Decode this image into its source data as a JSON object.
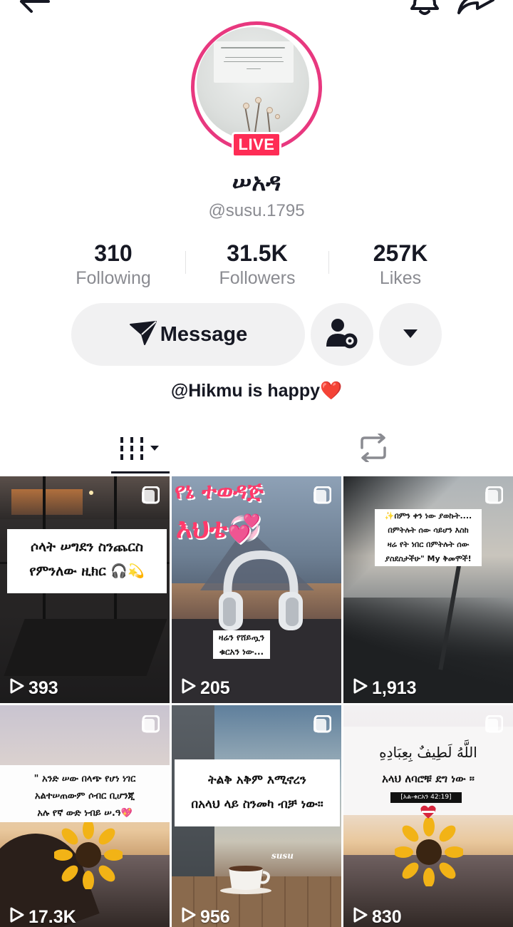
{
  "profile": {
    "name": "ሠአዳ",
    "handle": "@susu.1795",
    "live_badge": "LIVE",
    "bio": "@Hikmu is happy❤️"
  },
  "stats": [
    {
      "value": "310",
      "label": "Following"
    },
    {
      "value": "31.5K",
      "label": "Followers"
    },
    {
      "value": "257K",
      "label": "Likes"
    }
  ],
  "actions": {
    "message_label": "Message"
  },
  "tabs": {
    "videos_icon": "grid-icon",
    "reposts_icon": "repost-icon"
  },
  "videos": [
    {
      "views": "393",
      "caption": [
        "ሶላት ሠግደን ስንጨርስ",
        "የምንለው ዚክር 🎧💫"
      ]
    },
    {
      "views": "205",
      "headline": "የኔ ተወዳጅ",
      "headline2": "እህቴ💞",
      "caption": [
        "ዛሬን የሸይጧን",
        "ቁርአን ነው..."
      ]
    },
    {
      "views": "1,913",
      "caption": [
        "✨በምን ቀን ነው ያወኩት....",
        "በምትሉት ሰው ሳይሆን እስከ",
        "ዛሬ የት ነበር በምትሉት ሰው",
        "ያስደስታችሁ\" My ቅመሞች!"
      ]
    },
    {
      "views": "17.3K",
      "caption": [
        "\" አንድ ሠው በላጭ የሆነ ነገር",
        "አልተሠጠውም ሶብር ቢሆንጂ",
        "አሉ የኛ ውድ ነብይ ሠ.ዓ💖"
      ]
    },
    {
      "views": "956",
      "caption": [
        "ትልቅ አቅም እሚኖረን",
        "በአላህ ላይ ስንመካ ብቻ ነው።"
      ],
      "watermark": "susu"
    },
    {
      "views": "830",
      "arabic": "اللَّهُ لَطِيفٌ بِعِبَادِهِ",
      "caption": [
        "አላህ ለባሮቹ ደግ ነው ።"
      ],
      "reference": "[አል-ቁርአን 42:19]"
    }
  ],
  "colors": {
    "accent": "#fe2c55",
    "ring": "#e8387f",
    "muted_text": "#8a8b91",
    "button_bg": "#f1f1f2"
  }
}
